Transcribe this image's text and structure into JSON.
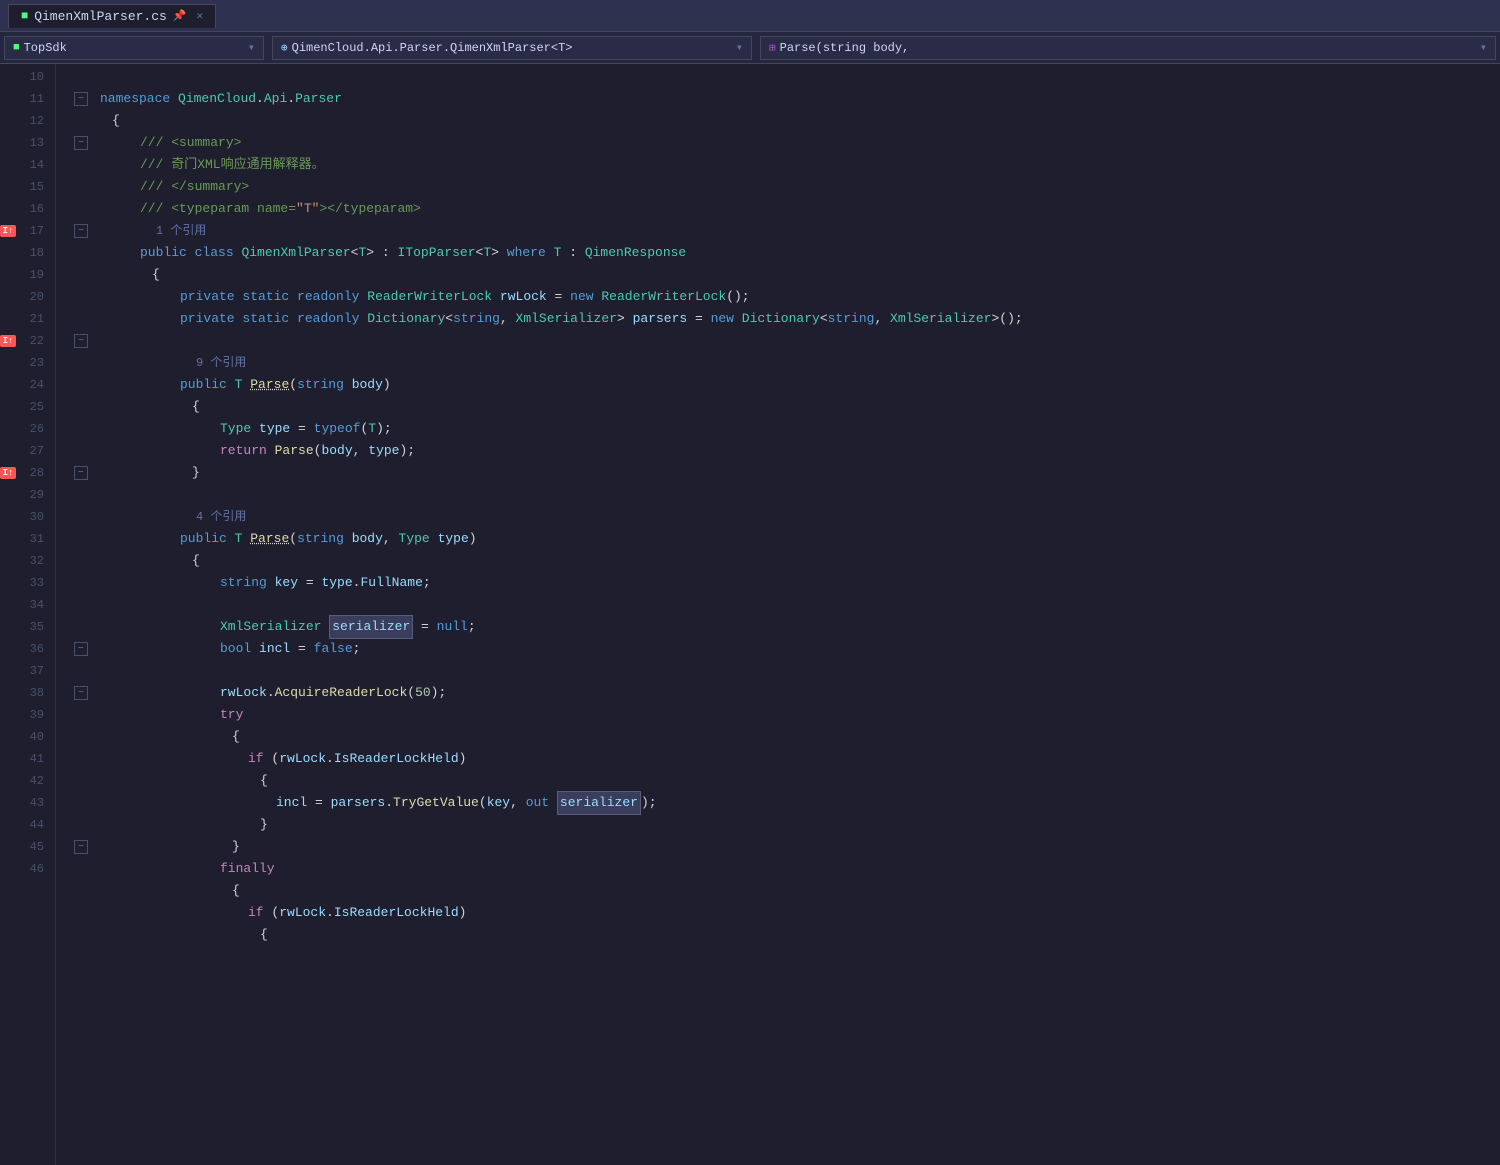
{
  "titleBar": {
    "tabName": "QimenXmlParser.cs",
    "tabIcon": "■",
    "closeLabel": "✕"
  },
  "navBar": {
    "dropdown1Icon": "■",
    "dropdown1Text": "TopSdk",
    "dropdown2Icon": "⊕",
    "dropdown2Text": "QimenCloud.Api.Parser.QimenXmlParser<T>",
    "dropdown3Text": "Parse(string body,",
    "arrowSymbol": "▾"
  },
  "lines": [
    {
      "num": 10,
      "bp": false,
      "content": ""
    },
    {
      "num": 11,
      "bp": false,
      "content": "namespace"
    },
    {
      "num": 12,
      "bp": false,
      "content": "{"
    },
    {
      "num": 13,
      "bp": false,
      "content": "summary"
    },
    {
      "num": 14,
      "bp": false,
      "content": "comment_cn"
    },
    {
      "num": 15,
      "bp": false,
      "content": "summary_end"
    },
    {
      "num": 16,
      "bp": false,
      "content": "typeparam"
    },
    {
      "num": 17,
      "bp": true,
      "content": "class_decl"
    },
    {
      "num": 18,
      "bp": false,
      "content": "{"
    },
    {
      "num": 19,
      "bp": false,
      "content": "field1"
    },
    {
      "num": 20,
      "bp": false,
      "content": "field2"
    },
    {
      "num": 21,
      "bp": false,
      "content": ""
    },
    {
      "num": 22,
      "bp": true,
      "content": "method1"
    },
    {
      "num": 23,
      "bp": false,
      "content": "{"
    },
    {
      "num": 24,
      "bp": false,
      "content": "type_typeof"
    },
    {
      "num": 25,
      "bp": false,
      "content": "return_parse"
    },
    {
      "num": 26,
      "bp": false,
      "content": "}"
    },
    {
      "num": 27,
      "bp": false,
      "content": ""
    },
    {
      "num": 28,
      "bp": true,
      "content": "method2"
    },
    {
      "num": 29,
      "bp": false,
      "content": "{"
    },
    {
      "num": 30,
      "bp": false,
      "content": "string_key"
    },
    {
      "num": 31,
      "bp": false,
      "content": ""
    },
    {
      "num": 32,
      "bp": false,
      "content": "xml_serializer"
    },
    {
      "num": 33,
      "bp": false,
      "content": "bool_incl"
    },
    {
      "num": 34,
      "bp": false,
      "content": ""
    },
    {
      "num": 35,
      "bp": false,
      "content": "rwlock_acquire"
    },
    {
      "num": 36,
      "bp": false,
      "content": "try"
    },
    {
      "num": 37,
      "bp": false,
      "content": "{"
    },
    {
      "num": 38,
      "bp": false,
      "content": "if_rwlock"
    },
    {
      "num": 39,
      "bp": false,
      "content": "{"
    },
    {
      "num": 40,
      "bp": false,
      "content": "incl_assign"
    },
    {
      "num": 41,
      "bp": false,
      "content": "}"
    },
    {
      "num": 42,
      "bp": false,
      "content": "}"
    },
    {
      "num": 43,
      "bp": false,
      "content": "finally"
    },
    {
      "num": 44,
      "bp": false,
      "content": "{"
    },
    {
      "num": 45,
      "bp": false,
      "content": "if_rwlock2"
    },
    {
      "num": 46,
      "bp": false,
      "content": "{"
    }
  ],
  "colors": {
    "background": "#1e1e2e",
    "gutter": "#1e1e2e",
    "titleBar": "#2e3250",
    "navBar": "#252640",
    "lineNum": "#4a5068",
    "keyword": "#569cd6",
    "controlFlow": "#c586c0",
    "type": "#4ec9b0",
    "string": "#ce9178",
    "comment": "#6a9955",
    "variable": "#9cdcfe",
    "method": "#dcdcaa",
    "plain": "#d4d4d4",
    "number": "#b5cea8",
    "breakpoint": "#ff5555"
  }
}
